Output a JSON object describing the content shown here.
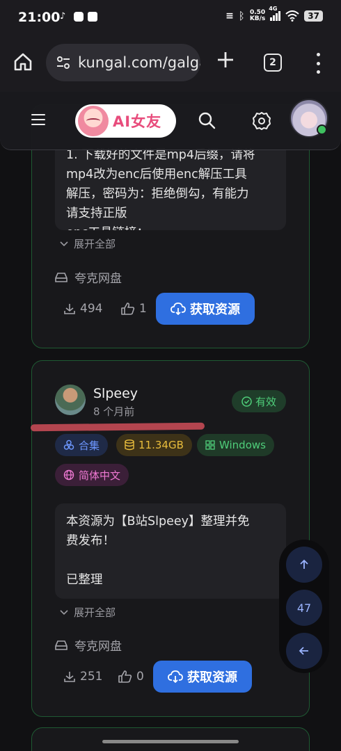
{
  "status_bar": {
    "time": "21:00",
    "net_speed_value": "0.50",
    "net_speed_unit": "KB/s",
    "network_type": "4G",
    "battery": "37"
  },
  "browser": {
    "url": "kungal.com/galga",
    "tab_count": "2"
  },
  "site_header": {
    "logo_text": "AI女友"
  },
  "card1": {
    "description_lines": [
      "1. 下载好的文件是mp4后缀，请将",
      "mp4改为enc后使用enc解压工具",
      "解压，密码为：拒绝倒勾，有能力",
      "请支持正版",
      "enc工具链接："
    ],
    "expand_label": "展开全部",
    "storage_label": "夸克网盘",
    "downloads": "494",
    "likes": "1",
    "get_button": "获取资源"
  },
  "card2": {
    "author": "Slpeey",
    "time_ago": "8 个月前",
    "status_badge": "有效",
    "tags": {
      "collection": "合集",
      "size": "11.34GB",
      "platform": "Windows",
      "language": "简体中文"
    },
    "description_lines": [
      "本资源为【B站Slpeey】整理并免",
      "费发布！",
      "",
      "已整理"
    ],
    "expand_label": "展开全部",
    "storage_label": "夸克网盘",
    "downloads": "251",
    "likes": "0",
    "get_button": "获取资源"
  },
  "floating": {
    "count": "47"
  },
  "colors": {
    "accent_blue": "#2f6fe0",
    "card_border": "#1f5a33",
    "valid_green": "#4fce7a",
    "highlight_red": "#c44a55"
  }
}
